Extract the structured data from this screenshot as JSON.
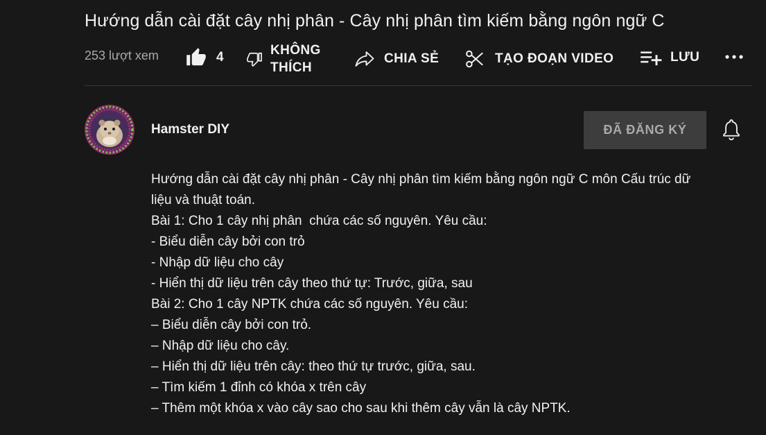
{
  "video": {
    "title": "Hướng dẫn cài đặt cây nhị phân - Cây nhị phân tìm kiếm bằng ngôn ngữ C",
    "views": "253 lượt xem"
  },
  "actions": {
    "like_count": "4",
    "dislike_line1": "KHÔNG",
    "dislike_line2": "THÍCH",
    "share_label": "CHIA SẺ",
    "clip_label": "TẠO ĐOẠN VIDEO",
    "save_label": "LƯU",
    "more_label": "..."
  },
  "channel": {
    "name": "Hamster DIY",
    "subscribe_label": "ĐÃ ĐĂNG KÝ"
  },
  "description": {
    "lines": [
      "Hướng dẫn cài đặt cây nhị phân - Cây nhị phân tìm kiếm bằng ngôn ngữ C môn Cấu trúc dữ",
      "liệu và thuật toán.",
      "Bài 1: Cho 1 cây nhị phân  chứa các số nguyên. Yêu cầu:",
      "- Biểu diễn cây bởi con trỏ",
      "- Nhập dữ liệu cho cây",
      "- Hiển thị dữ liệu trên cây theo thứ tự: Trước, giữa, sau",
      "Bài 2: Cho 1 cây NPTK chứa các số nguyên. Yêu cầu:",
      "– Biểu diễn cây bởi con trỏ.",
      "– Nhập dữ liệu cho cây.",
      "– Hiển thị dữ liệu trên cây: theo thứ tự trước, giữa, sau.",
      "– Tìm kiếm 1 đỉnh có khóa x trên cây",
      "– Thêm một khóa x vào cây sao cho sau khi thêm cây vẫn là cây NPTK."
    ]
  },
  "colors": {
    "background": "#181818",
    "text_primary": "#f1f1f1",
    "text_secondary": "#aaaaaa",
    "subscribed_bg": "#3d3d3d",
    "divider": "#3a3a3a"
  },
  "icons": [
    "thumbs-up-icon",
    "thumbs-down-icon",
    "share-icon",
    "scissors-icon",
    "playlist-add-icon",
    "more-horizontal-icon",
    "bell-icon"
  ]
}
